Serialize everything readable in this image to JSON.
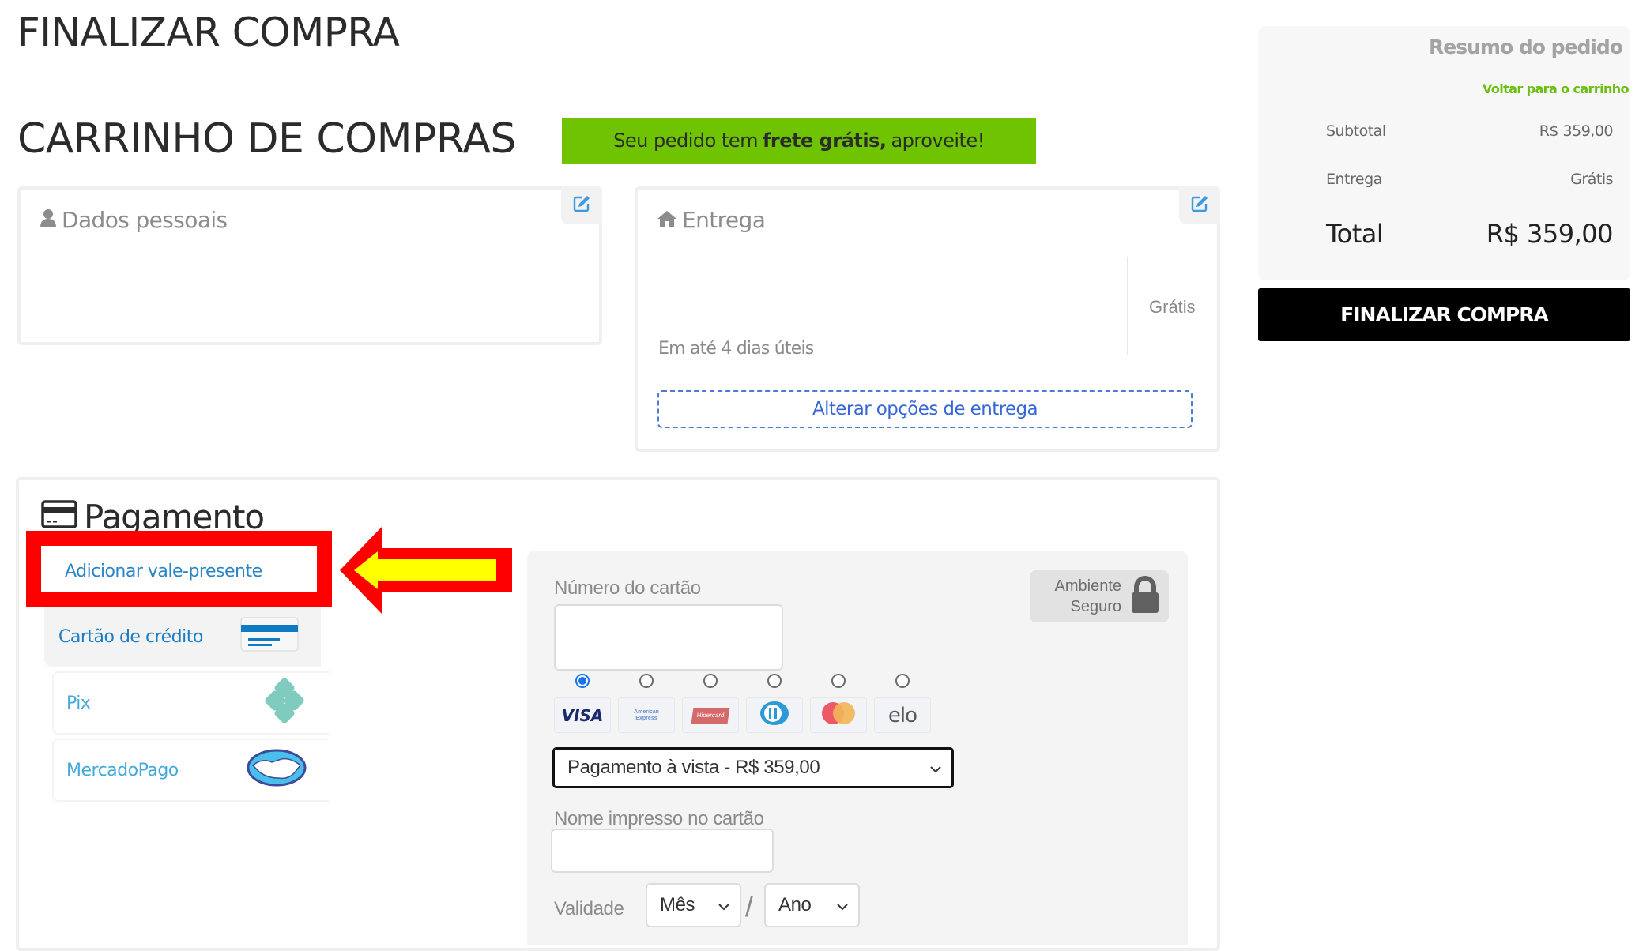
{
  "page": {
    "title": "FINALIZAR COMPRA",
    "cart_title": "CARRINHO DE COMPRAS",
    "banner": {
      "prefix": "Seu pedido tem",
      "highlight": "frete grátis,",
      "suffix": "aproveite!",
      "color": "#6fc300"
    }
  },
  "personal": {
    "title": "Dados pessoais",
    "icon": "user-icon",
    "edit_icon": "edit-icon"
  },
  "delivery": {
    "title": "Entrega",
    "icon": "home-icon",
    "edit_icon": "edit-icon",
    "price": "Grátis",
    "time": "Em até 4 dias úteis",
    "change_label": "Alterar opções de entrega"
  },
  "payment": {
    "title": "Pagamento",
    "icon": "credit-card-icon",
    "methods": [
      {
        "label": "Adicionar vale-presente",
        "icon": ""
      },
      {
        "label": "Cartão de crédito",
        "icon": "credit-card-icon",
        "selected": true
      },
      {
        "label": "Pix",
        "icon": "pix-icon"
      },
      {
        "label": "MercadoPago",
        "icon": "mercadopago-icon"
      }
    ],
    "card_form": {
      "number_label": "Número do cartão",
      "number_value": "",
      "secure_line1": "Ambiente",
      "secure_line2": "Seguro",
      "brands": [
        "VISA",
        "American Express",
        "Hipercard",
        "Diners",
        "Mastercard",
        "elo"
      ],
      "selected_brand": "VISA",
      "installments_value": "Pagamento à vista - R$ 359,00",
      "name_label": "Nome impresso no cartão",
      "name_value": "",
      "validity_label": "Validade",
      "month_placeholder": "Mês",
      "year_placeholder": "Ano",
      "separator": "/"
    }
  },
  "annotation": {
    "box_color": "#ff0000",
    "arrow_fill": "#ffff00",
    "target": "Adicionar vale-presente"
  },
  "summary": {
    "title": "Resumo do pedido",
    "back_link": "Voltar para o carrinho",
    "subtotal_label": "Subtotal",
    "subtotal_value": "R$ 359,00",
    "delivery_label": "Entrega",
    "delivery_value": "Grátis",
    "total_label": "Total",
    "total_value": "R$ 359,00",
    "finish_label": "FINALIZAR COMPRA"
  }
}
